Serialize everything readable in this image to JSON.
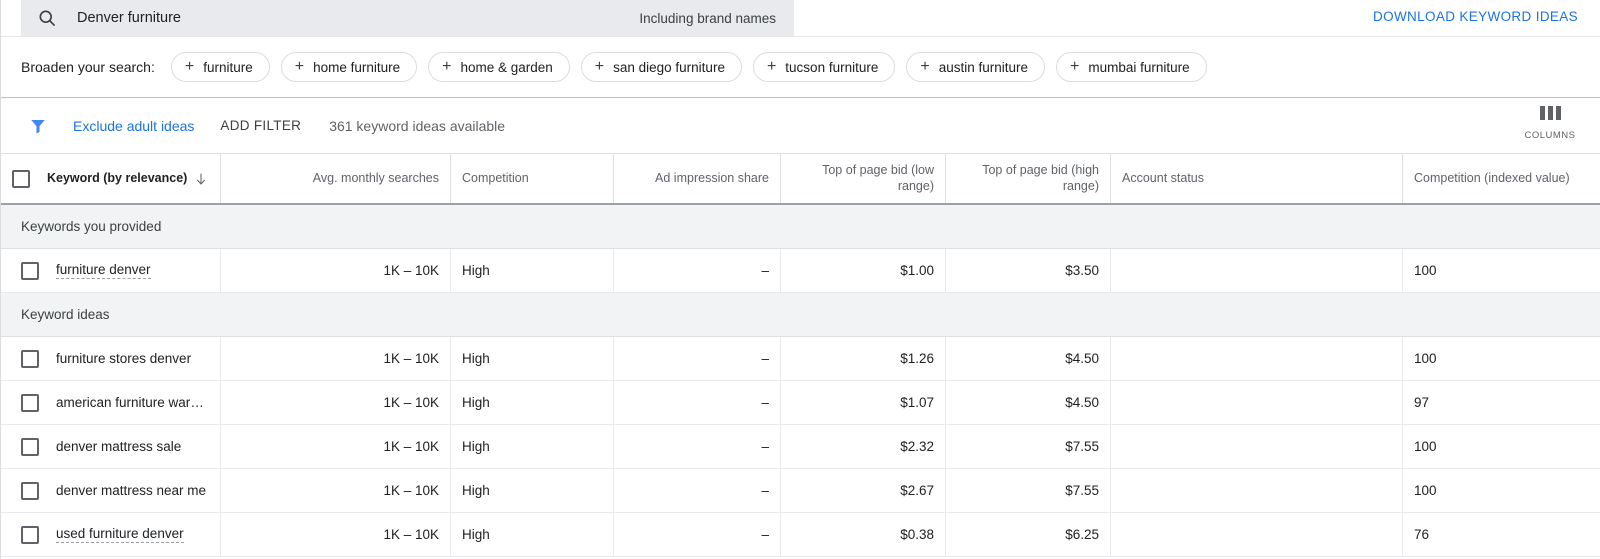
{
  "search": {
    "icon": "search-icon",
    "query": "Denver furniture",
    "brand_note": "Including brand names",
    "download_label": "DOWNLOAD KEYWORD IDEAS",
    "link_color": "#1a73e8"
  },
  "broaden": {
    "label": "Broaden your search:",
    "chips": [
      {
        "plus": "+",
        "label": "furniture"
      },
      {
        "plus": "+",
        "label": "home furniture"
      },
      {
        "plus": "+",
        "label": "home & garden"
      },
      {
        "plus": "+",
        "label": "san diego furniture"
      },
      {
        "plus": "+",
        "label": "tucson furniture"
      },
      {
        "plus": "+",
        "label": "austin furniture"
      },
      {
        "plus": "+",
        "label": "mumbai furniture"
      }
    ]
  },
  "filters": {
    "funnel_icon": "filter-funnel-icon",
    "exclude_label": "Exclude adult ideas",
    "add_filter_label": "ADD FILTER",
    "count_label": "361 keyword ideas available",
    "columns_label": "COLUMNS"
  },
  "table": {
    "headers": [
      "Keyword (by relevance)",
      "Avg. monthly searches",
      "Competition",
      "Ad impression share",
      "Top of page bid (low range)",
      "Top of page bid (high range)",
      "Account status",
      "Competition (indexed value)"
    ],
    "sort_icon": "sort-descending-arrow-icon",
    "sections": [
      {
        "title": "Keywords you provided",
        "rows": [
          {
            "keyword": "furniture denver",
            "keyword_dotted": true,
            "volume": "1K – 10K",
            "competition": "High",
            "impression_share": "–",
            "bid_low": "$1.00",
            "bid_high": "$3.50",
            "account_status": "",
            "competition_index": "100"
          }
        ]
      },
      {
        "title": "Keyword ideas",
        "rows": [
          {
            "keyword": "furniture stores denver",
            "keyword_dotted": false,
            "volume": "1K – 10K",
            "competition": "High",
            "impression_share": "–",
            "bid_low": "$1.26",
            "bid_high": "$4.50",
            "account_status": "",
            "competition_index": "100"
          },
          {
            "keyword": "american furniture ware…",
            "keyword_dotted": false,
            "volume": "1K – 10K",
            "competition": "High",
            "impression_share": "–",
            "bid_low": "$1.07",
            "bid_high": "$4.50",
            "account_status": "",
            "competition_index": "97"
          },
          {
            "keyword": "denver mattress sale",
            "keyword_dotted": false,
            "volume": "1K – 10K",
            "competition": "High",
            "impression_share": "–",
            "bid_low": "$2.32",
            "bid_high": "$7.55",
            "account_status": "",
            "competition_index": "100"
          },
          {
            "keyword": "denver mattress near me",
            "keyword_dotted": false,
            "volume": "1K – 10K",
            "competition": "High",
            "impression_share": "–",
            "bid_low": "$2.67",
            "bid_high": "$7.55",
            "account_status": "",
            "competition_index": "100"
          },
          {
            "keyword": "used furniture denver",
            "keyword_dotted": true,
            "volume": "1K – 10K",
            "competition": "High",
            "impression_share": "–",
            "bid_low": "$0.38",
            "bid_high": "$6.25",
            "account_status": "",
            "competition_index": "76"
          }
        ]
      }
    ]
  }
}
